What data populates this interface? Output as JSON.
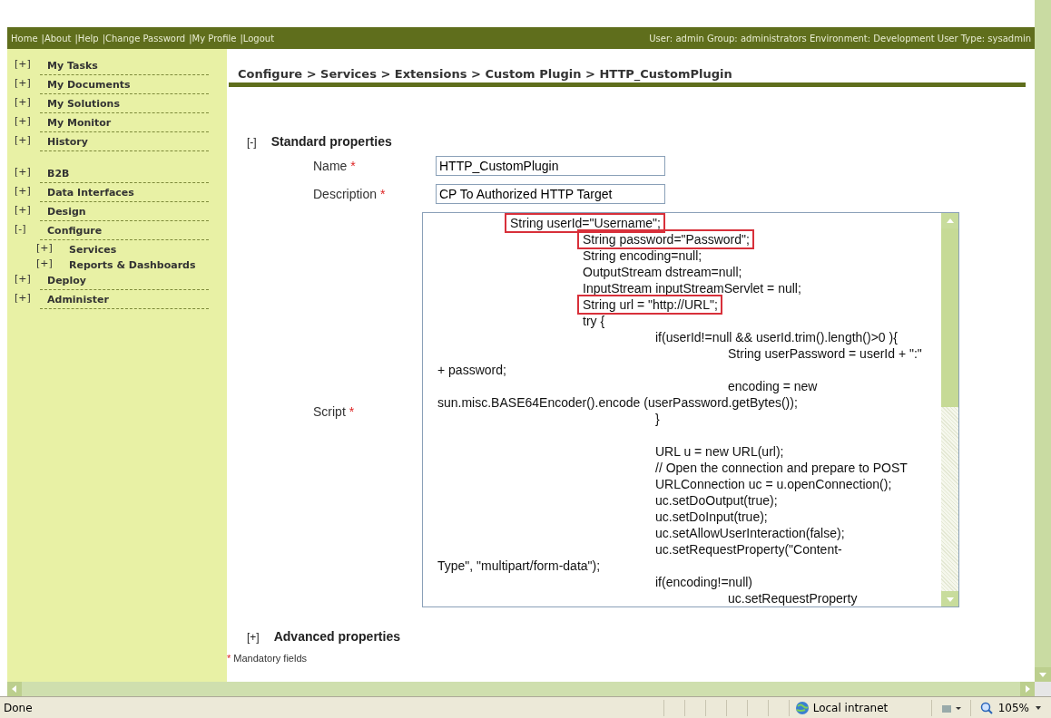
{
  "top_bar": {
    "links": [
      "Home",
      "About",
      "Help",
      "Change Password",
      "My Profile",
      "Logout"
    ],
    "separator": "|",
    "user_info": "User: admin Group: administrators Environment: Development User Type: sysadmin"
  },
  "sidebar": {
    "groups": [
      {
        "items": [
          {
            "toggle": "[+]",
            "label": "My Tasks"
          },
          {
            "toggle": "[+]",
            "label": "My Documents"
          },
          {
            "toggle": "[+]",
            "label": "My Solutions"
          },
          {
            "toggle": "[+]",
            "label": "My Monitor"
          },
          {
            "toggle": "[+]",
            "label": "History"
          }
        ]
      },
      {
        "items": [
          {
            "toggle": "[+]",
            "label": "B2B"
          },
          {
            "toggle": "[+]",
            "label": "Data Interfaces"
          },
          {
            "toggle": "[+]",
            "label": "Design"
          },
          {
            "toggle": "[-]",
            "label": "Configure",
            "children": [
              {
                "toggle": "[+]",
                "label": "Services"
              },
              {
                "toggle": "[+]",
                "label": "Reports & Dashboards"
              }
            ]
          },
          {
            "toggle": "[+]",
            "label": "Deploy"
          },
          {
            "toggle": "[+]",
            "label": "Administer"
          }
        ]
      }
    ]
  },
  "breadcrumb": "Configure > Services > Extensions > Custom Plugin > HTTP_CustomPlugin",
  "sections": [
    {
      "toggle": "[-]",
      "title": "Standard properties",
      "fields": [
        {
          "kind": "text",
          "label": "Name",
          "required_mark": "*",
          "value": "HTTP_CustomPlugin"
        },
        {
          "kind": "text",
          "label": "Description",
          "required_mark": "*",
          "value": "CP To Authorized HTTP Target"
        },
        {
          "kind": "code",
          "label": "Script",
          "required_mark": "*",
          "lines": [
            {
              "text": "\tString userId=\"Username\";",
              "highlighted": true
            },
            {
              "text": "\t\tString password=\"Password\";",
              "highlighted": true
            },
            {
              "text": "\t\tString encoding=null;",
              "highlighted": false
            },
            {
              "text": "\t\tOutputStream dstream=null;",
              "highlighted": false
            },
            {
              "text": "\t\tInputStream inputStreamServlet = null;",
              "highlighted": false
            },
            {
              "text": "\t\tString url = \"http://URL\";",
              "highlighted": true
            },
            {
              "text": "\t\ttry {",
              "highlighted": false
            },
            {
              "text": "\t\t\tif(userId!=null && userId.trim().length()>0 ){",
              "highlighted": false
            },
            {
              "text": "\t\t\t\tString userPassword = userId + \":\"",
              "highlighted": false
            },
            {
              "text": "+ password;",
              "highlighted": false
            },
            {
              "text": "\t\t\t\tencoding = new",
              "highlighted": false
            },
            {
              "text": "sun.misc.BASE64Encoder().encode (userPassword.getBytes());",
              "highlighted": false
            },
            {
              "text": "\t\t\t}",
              "highlighted": false
            },
            {
              "text": "\t\t\tURL u = new URL(url);",
              "highlighted": false,
              "blank_before": true
            },
            {
              "text": "\t\t\t// Open the connection and prepare to POST",
              "highlighted": false
            },
            {
              "text": "\t\t\tURLConnection uc = u.openConnection();",
              "highlighted": false
            },
            {
              "text": "\t\t\tuc.setDoOutput(true);",
              "highlighted": false
            },
            {
              "text": "\t\t\tuc.setDoInput(true);",
              "highlighted": false
            },
            {
              "text": "\t\t\tuc.setAllowUserInteraction(false);",
              "highlighted": false
            },
            {
              "text": "\t\t\tuc.setRequestProperty(\"Content-",
              "highlighted": false
            },
            {
              "text": "Type\", \"multipart/form-data\");",
              "highlighted": false
            },
            {
              "text": "\t\t\tif(encoding!=null)",
              "highlighted": false
            },
            {
              "text": "\t\t\t\tuc.setRequestProperty",
              "highlighted": false
            }
          ]
        }
      ]
    },
    {
      "toggle": "[+]",
      "title": "Advanced properties"
    }
  ],
  "footnote": {
    "mark": "*",
    "text": "Mandatory fields"
  },
  "status_bar": {
    "status": "Done",
    "zone": "Local intranet",
    "zoom": "105%"
  }
}
